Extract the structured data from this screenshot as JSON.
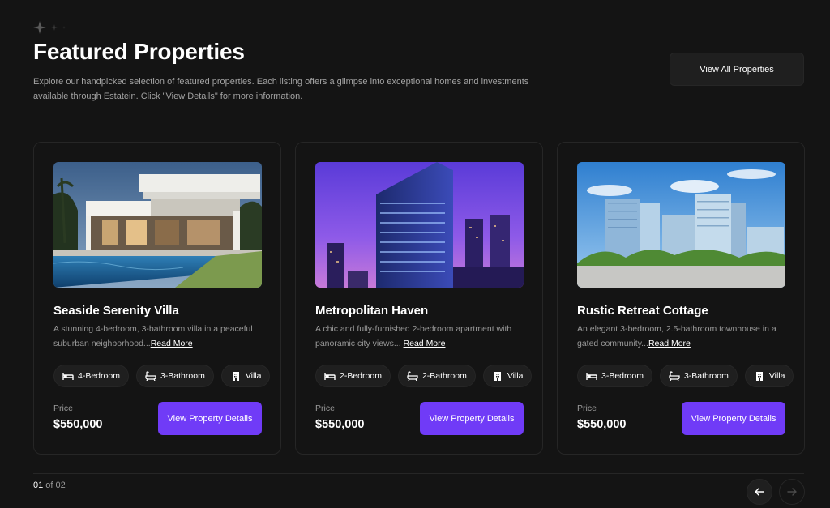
{
  "header": {
    "title": "Featured Properties",
    "subtitle": "Explore our handpicked selection of featured properties. Each listing offers a glimpse into exceptional homes and investments available through Estatein. Click \"View Details\" for more information.",
    "view_all_label": "View All Properties"
  },
  "cards": [
    {
      "name": "Seaside Serenity Villa",
      "description": "A stunning 4-bedroom, 3-bathroom villa in a peaceful suburban neighborhood...",
      "read_more": "Read More",
      "bedrooms": "4-Bedroom",
      "bathrooms": "3-Bathroom",
      "type": "Villa",
      "price_label": "Price",
      "price": "$550,000",
      "button_label": "View Property Details"
    },
    {
      "name": "Metropolitan Haven",
      "description": "A chic and fully-furnished 2-bedroom apartment with panoramic city views... ",
      "read_more": "Read More",
      "bedrooms": "2-Bedroom",
      "bathrooms": "2-Bathroom",
      "type": "Villa",
      "price_label": "Price",
      "price": "$550,000",
      "button_label": "View Property Details"
    },
    {
      "name": "Rustic Retreat Cottage",
      "description": "An elegant 3-bedroom, 2.5-bathroom townhouse in a gated community...",
      "read_more": "Read More",
      "bedrooms": "3-Bedroom",
      "bathrooms": "3-Bathroom",
      "type": "Villa",
      "price_label": "Price",
      "price": "$550,000",
      "button_label": "View Property Details"
    }
  ],
  "pagination": {
    "current": "01",
    "separator": " of ",
    "total": "02"
  },
  "icons": {
    "sparkle": "sparkle-icon",
    "bed": "bed-icon",
    "bath": "bath-icon",
    "building": "building-icon",
    "prev": "arrow-left-icon",
    "next": "arrow-right-icon"
  },
  "colors": {
    "background": "#141414",
    "accent": "#703bf7",
    "border": "#262626",
    "muted_text": "#999999"
  }
}
